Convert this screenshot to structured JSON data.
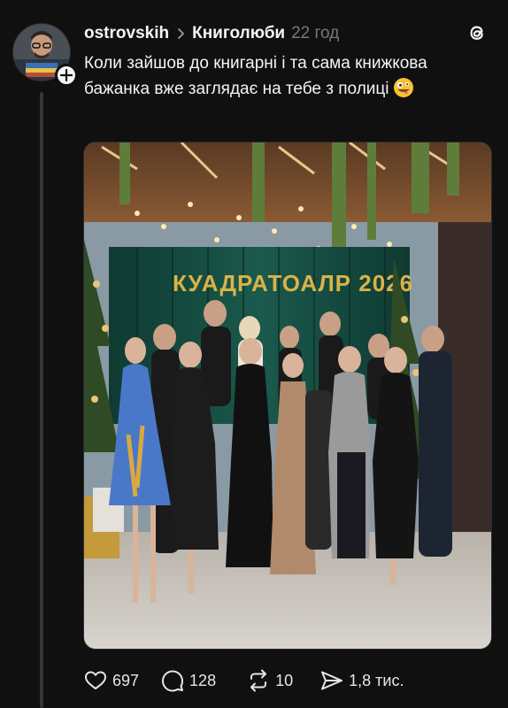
{
  "post": {
    "username": "ostrovskih",
    "community": "Книголюби",
    "time": "22 год",
    "text": "Коли зайшов до книгарні і та сама книжкова бажанка вже заглядає на тебе з полиці",
    "photo_banner_text": "КУАДРАТОАЛР 2026"
  },
  "actions": {
    "likes": "697",
    "replies": "128",
    "reposts": "10",
    "shares": "1,8 тис."
  },
  "colors": {
    "background": "#101010",
    "text": "#f3f5f7",
    "muted": "#777777",
    "thread_line": "#333638"
  },
  "icons": [
    "plus-icon",
    "chevron-right-icon",
    "threads-logo-icon",
    "zany-face-emoji",
    "heart-icon",
    "comment-icon",
    "repost-icon",
    "share-icon"
  ]
}
